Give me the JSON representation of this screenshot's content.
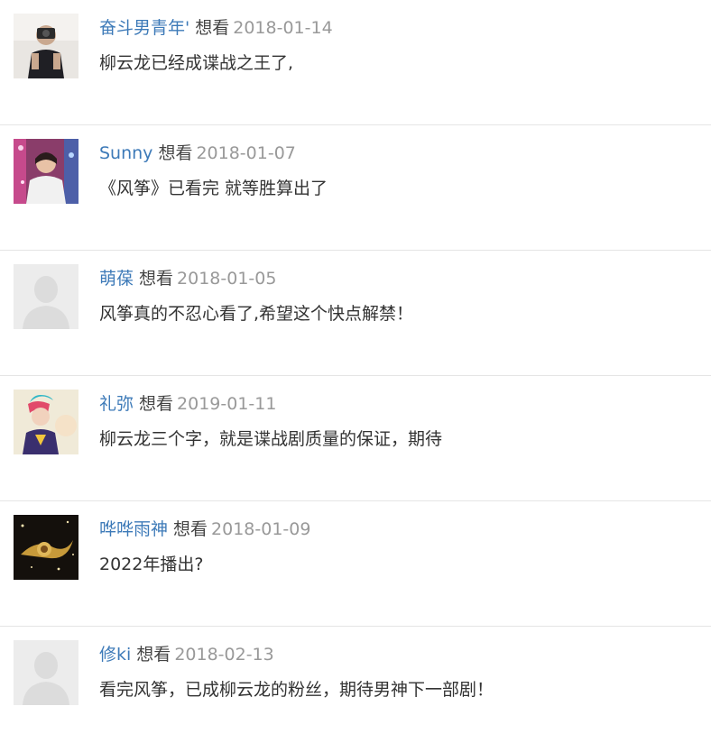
{
  "comments": [
    {
      "user": "奋斗男青年'",
      "action": "想看",
      "date": "2018-01-14",
      "text": "柳云龙已经成谍战之王了,",
      "avatar_icon": "photo-avatar"
    },
    {
      "user": "Sunny",
      "action": "想看",
      "date": "2018-01-07",
      "text": "《风筝》已看完 就等胜算出了",
      "avatar_icon": "photo-avatar"
    },
    {
      "user": "萌葆",
      "action": "想看",
      "date": "2018-01-05",
      "text": "风筝真的不忍心看了,希望这个快点解禁！",
      "avatar_icon": "default-avatar"
    },
    {
      "user": "礼弥",
      "action": "想看",
      "date": "2019-01-11",
      "text": "柳云龙三个字，就是谍战剧质量的保证，期待",
      "avatar_icon": "photo-avatar"
    },
    {
      "user": "哗哗雨神",
      "action": "想看",
      "date": "2018-01-09",
      "text": "2022年播出?",
      "avatar_icon": "photo-avatar"
    },
    {
      "user": "修ki",
      "action": "想看",
      "date": "2018-02-13",
      "text": "看完风筝，已成柳云龙的粉丝，期待男神下一部剧！",
      "avatar_icon": "default-avatar"
    }
  ],
  "colors": {
    "username": "#3d7ab8",
    "date": "#999999",
    "text": "#333333",
    "divider": "#e5e5e5"
  }
}
